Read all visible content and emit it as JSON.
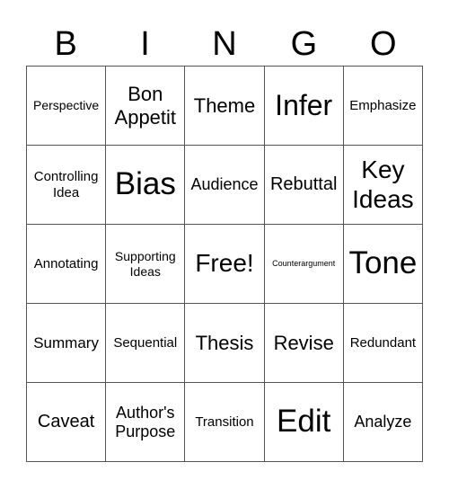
{
  "header": {
    "letters": [
      "B",
      "I",
      "N",
      "G",
      "O"
    ]
  },
  "board": {
    "rows": [
      [
        "Perspective",
        "Bon Appetit",
        "Theme",
        "Infer",
        "Emphasize"
      ],
      [
        "Controlling Idea",
        "Bias",
        "Audience",
        "Rebuttal",
        "Key Ideas"
      ],
      [
        "Annotating",
        "Supporting Ideas",
        "Free!",
        "Counterargument",
        "Tone"
      ],
      [
        "Summary",
        "Sequential",
        "Thesis",
        "Revise",
        "Redundant"
      ],
      [
        "Caveat",
        "Author's Purpose",
        "Transition",
        "Edit",
        "Analyze"
      ]
    ],
    "free_space": "Free!"
  }
}
